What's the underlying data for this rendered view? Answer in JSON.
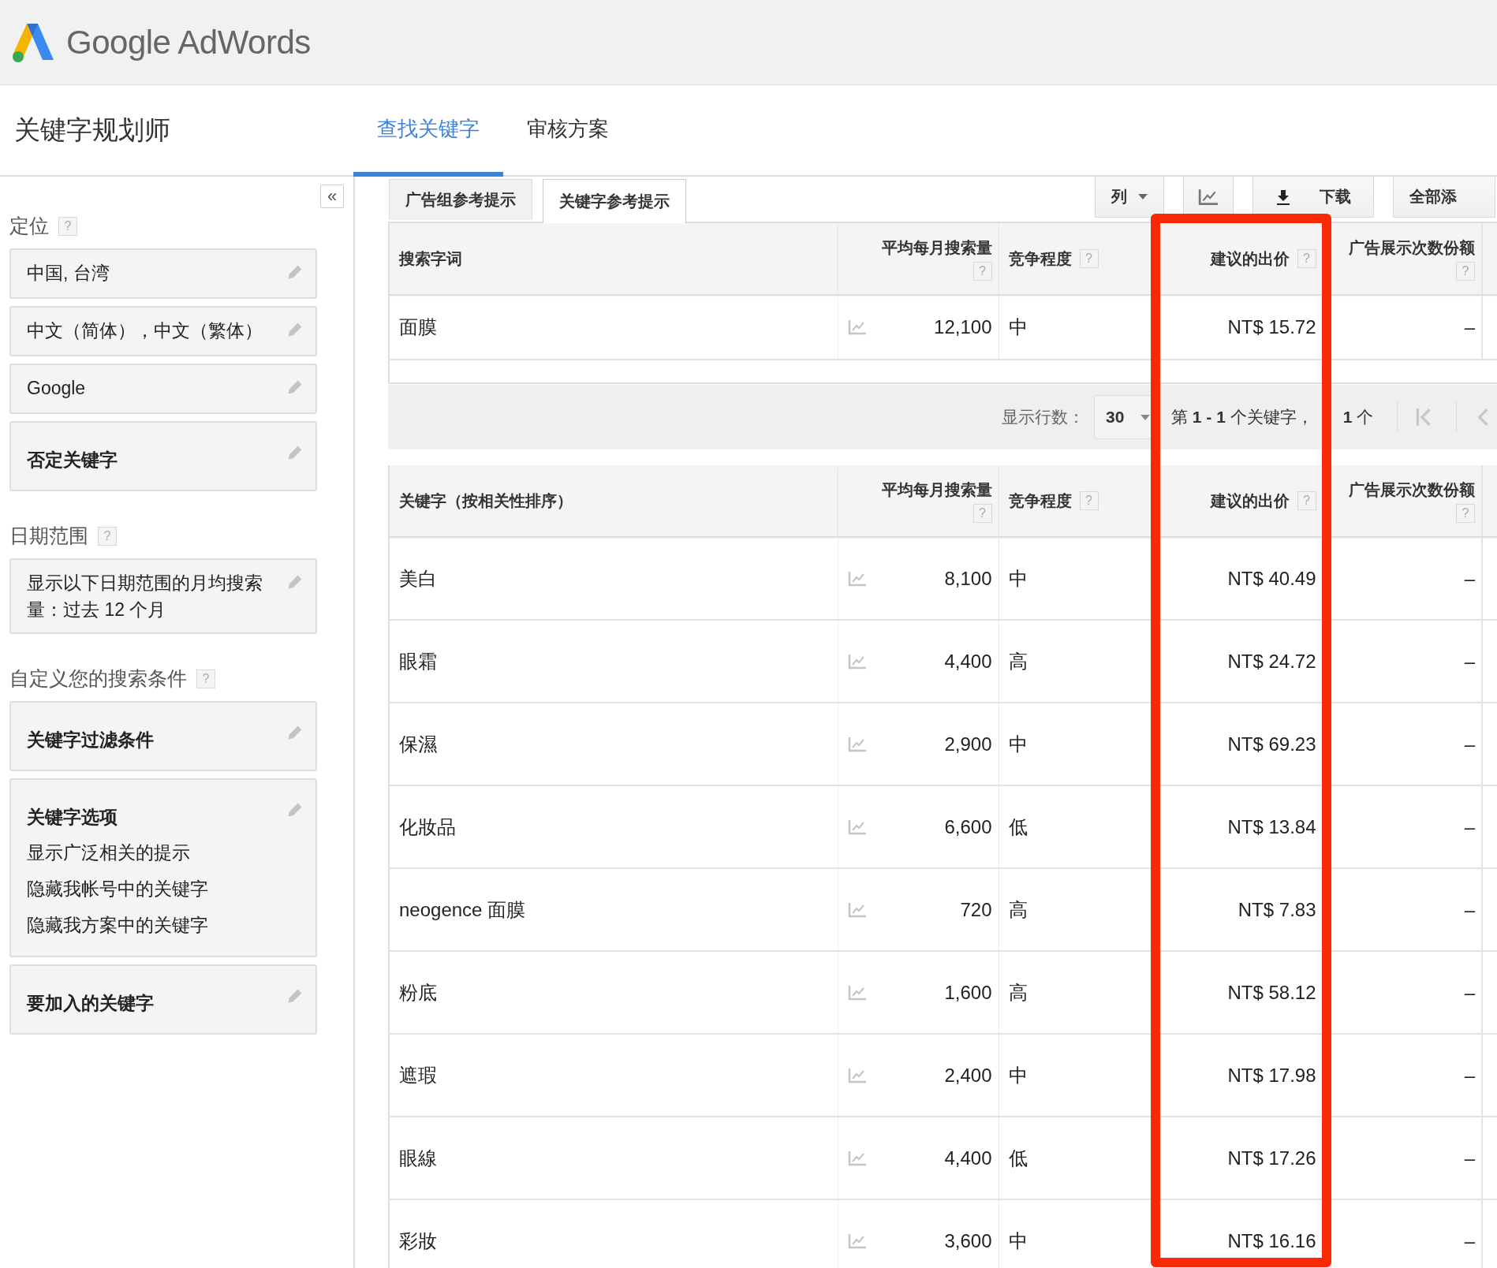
{
  "app": {
    "logo_text": "Google AdWords"
  },
  "page_title": "关键字规划师",
  "tabs": [
    {
      "label": "查找关键字",
      "selected": true
    },
    {
      "label": "审核方案",
      "selected": false
    }
  ],
  "sidebar": {
    "collapse_button": "«",
    "sections": [
      {
        "title": "定位",
        "help": "?",
        "cards": [
          {
            "lines": [
              "中国, 台湾"
            ]
          },
          {
            "lines": [
              "中文（简体），中文（繁体）"
            ]
          },
          {
            "lines": [
              "Google"
            ]
          },
          {
            "title": "否定关键字"
          }
        ]
      },
      {
        "title": "日期范围",
        "help": "?",
        "cards": [
          {
            "lines": [
              "显示以下日期范围的月均搜索量：过去 12 个月"
            ]
          }
        ]
      },
      {
        "title": "自定义您的搜索条件",
        "help": "?",
        "cards": [
          {
            "title": "关键字过滤条件"
          },
          {
            "title": "关键字选项",
            "lines": [
              "显示广泛相关的提示",
              "隐藏我帐号中的关键字",
              "隐藏我方案中的关键字"
            ]
          },
          {
            "title": "要加入的关键字"
          }
        ]
      }
    ]
  },
  "subtabs": [
    {
      "label": "广告组参考提示",
      "selected": false
    },
    {
      "label": "关键字参考提示",
      "selected": true
    }
  ],
  "toolbar": {
    "columns_button": "列",
    "download_button": "下载",
    "add_all_button": "全部添"
  },
  "search_terms_table": {
    "columns": [
      {
        "label": "搜索字词",
        "highlighted": false
      },
      {
        "label": "平均每月搜索量",
        "help": "?",
        "highlighted": false
      },
      {
        "label": "竞争程度",
        "help": "?",
        "highlighted": false
      },
      {
        "label": "建议的出价",
        "help": "?",
        "highlighted": true
      },
      {
        "label": "广告展示次数份额",
        "help": "?",
        "highlighted": false
      }
    ],
    "rows": [
      {
        "cells": [
          "面膜",
          "12,100",
          "中",
          "NT$ 15.72",
          "–"
        ]
      }
    ]
  },
  "pagination": {
    "rows_label": "显示行数：",
    "rows_value": "30",
    "range": "第 **1 - 1** 个关键字，",
    "total": "**1** 个"
  },
  "keywords_table": {
    "columns": [
      {
        "label": "关键字（按相关性排序）"
      },
      {
        "label": "平均每月搜索量",
        "help": "?"
      },
      {
        "label": "竞争程度",
        "help": "?"
      },
      {
        "label": "建议的出价",
        "help": "?"
      },
      {
        "label": "广告展示次数份额",
        "help": "?"
      }
    ],
    "rows": [
      {
        "cells": [
          "美白",
          "8,100",
          "中",
          "NT$ 40.49",
          "–"
        ]
      },
      {
        "cells": [
          "眼霜",
          "4,400",
          "高",
          "NT$ 24.72",
          "–"
        ]
      },
      {
        "cells": [
          "保濕",
          "2,900",
          "中",
          "NT$ 69.23",
          "–"
        ]
      },
      {
        "cells": [
          "化妝品",
          "6,600",
          "低",
          "NT$ 13.84",
          "–"
        ]
      },
      {
        "cells": [
          "neogence 面膜",
          "720",
          "高",
          "NT$ 7.83",
          "–"
        ]
      },
      {
        "cells": [
          "粉底",
          "1,600",
          "高",
          "NT$ 58.12",
          "–"
        ]
      },
      {
        "cells": [
          "遮瑕",
          "2,400",
          "中",
          "NT$ 17.98",
          "–"
        ]
      },
      {
        "cells": [
          "眼線",
          "4,400",
          "低",
          "NT$ 17.26",
          "–"
        ]
      },
      {
        "cells": [
          "彩妝",
          "3,600",
          "中",
          "NT$ 16.16",
          "–"
        ]
      }
    ]
  }
}
